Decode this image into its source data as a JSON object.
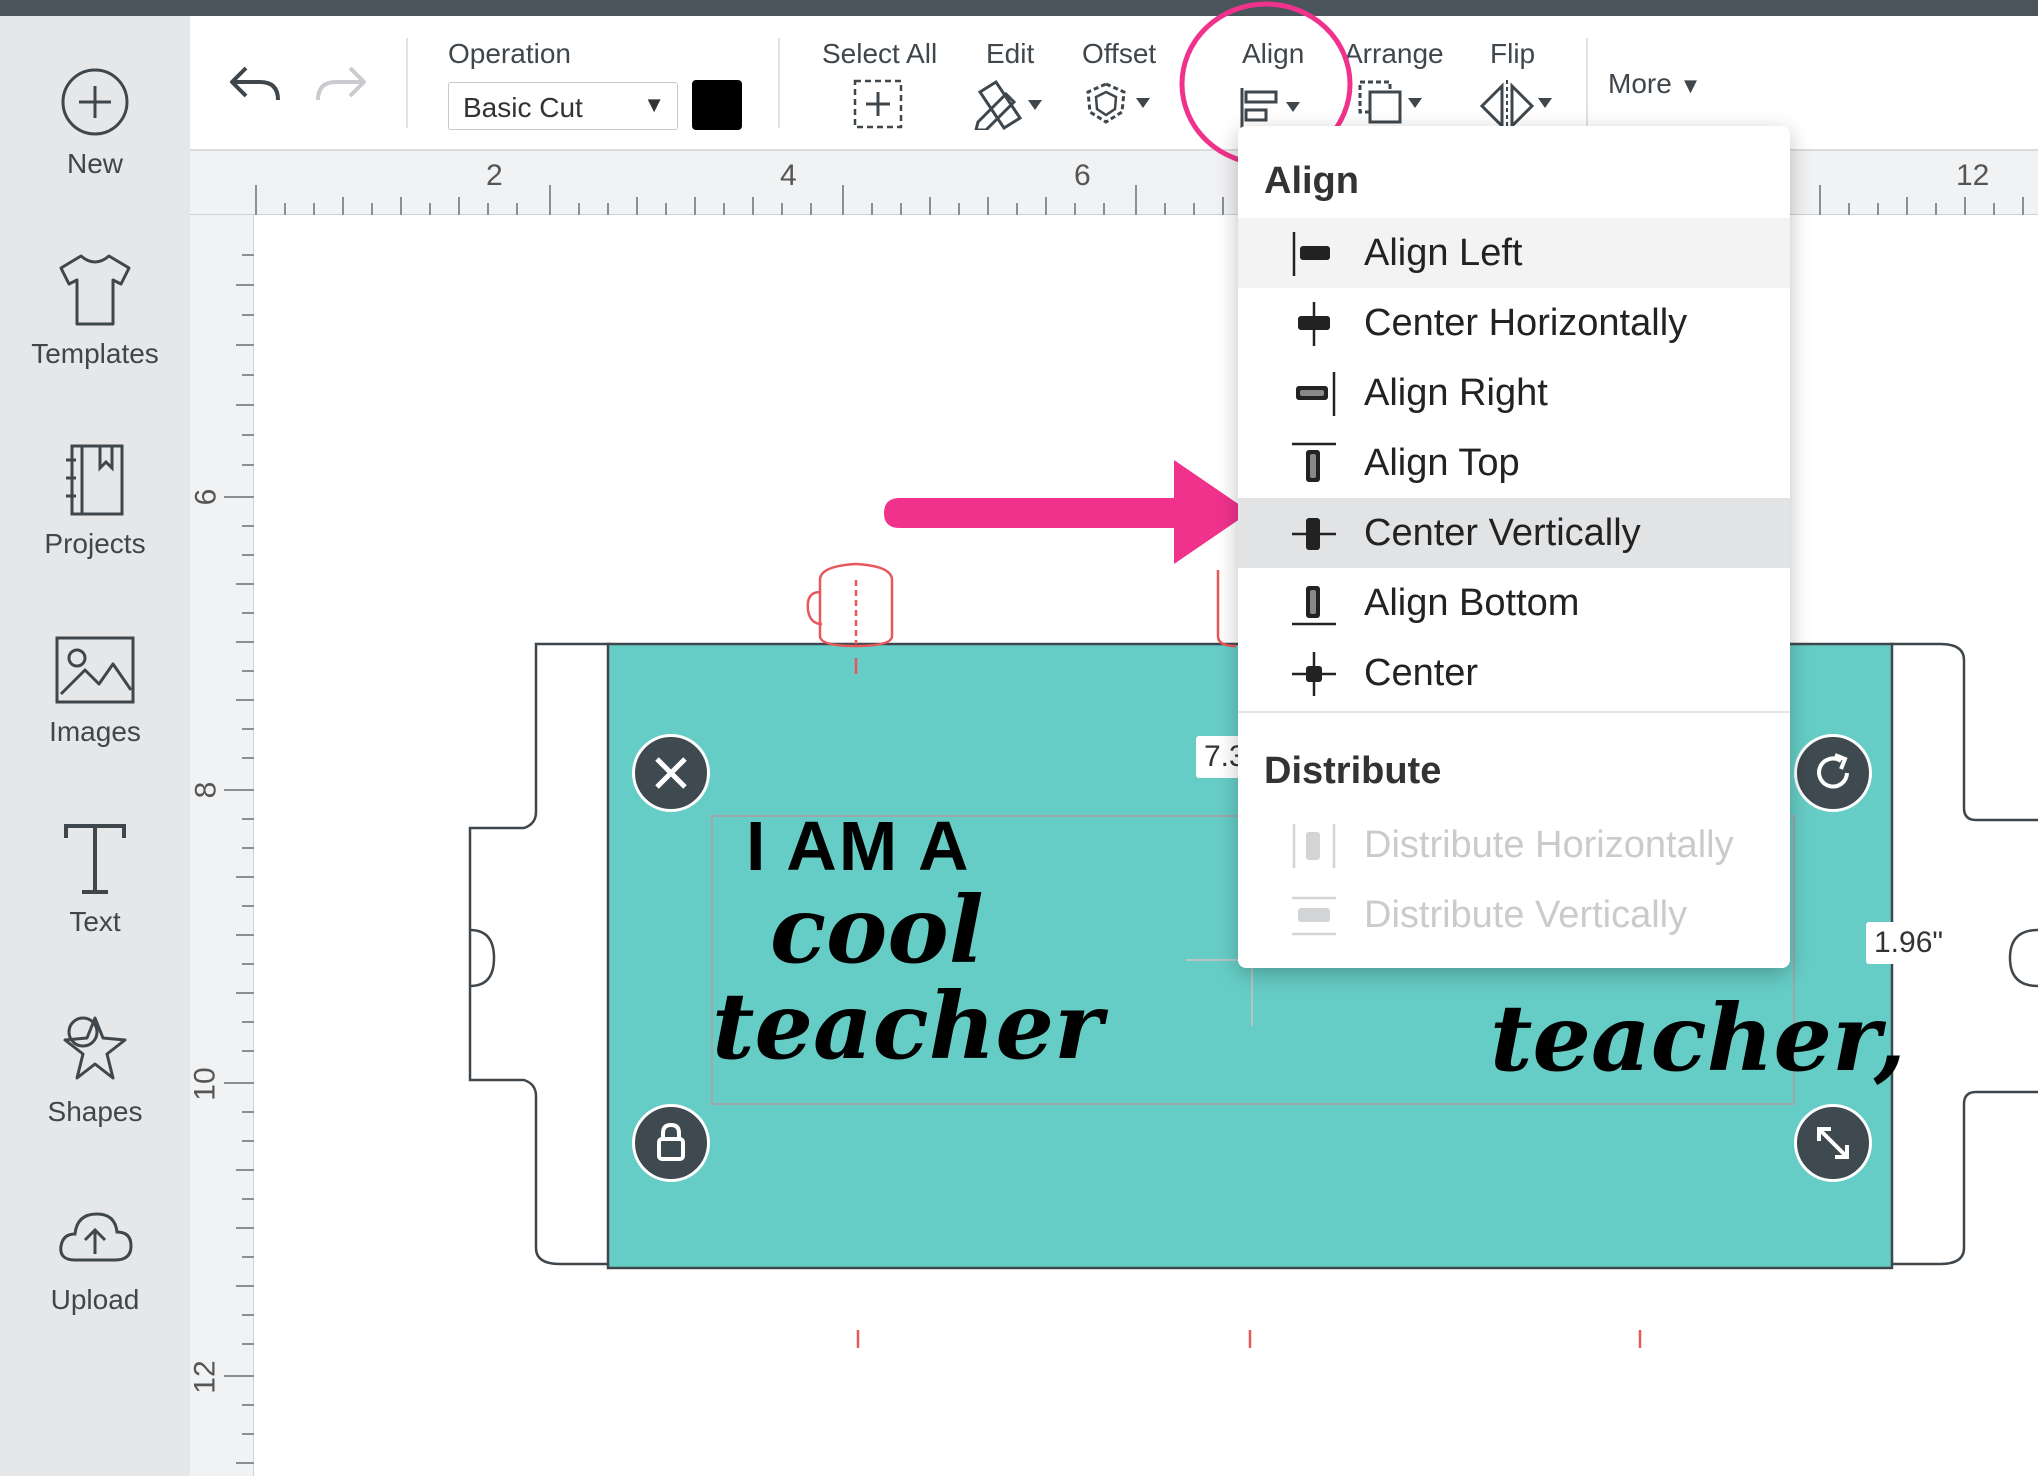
{
  "sidebar": {
    "items": [
      {
        "label": "New",
        "icon": "plus-circle-icon"
      },
      {
        "label": "Templates",
        "icon": "tshirt-icon"
      },
      {
        "label": "Projects",
        "icon": "notebook-icon"
      },
      {
        "label": "Images",
        "icon": "image-icon"
      },
      {
        "label": "Text",
        "icon": "text-t-icon"
      },
      {
        "label": "Shapes",
        "icon": "shapes-icon"
      },
      {
        "label": "Upload",
        "icon": "cloud-upload-icon"
      }
    ]
  },
  "toolbar": {
    "operation_label": "Operation",
    "operation_value": "Basic Cut",
    "operation_color": "#000000",
    "select_all_label": "Select All",
    "edit_label": "Edit",
    "offset_label": "Offset",
    "align_label": "Align",
    "arrange_label": "Arrange",
    "flip_label": "Flip",
    "more_label": "More"
  },
  "ruler": {
    "horizontal": [
      "2",
      "4",
      "6",
      "12"
    ],
    "vertical": [
      "6",
      "8",
      "10",
      "12"
    ]
  },
  "align_menu": {
    "align_heading": "Align",
    "items": [
      {
        "label": "Align Left",
        "icon": "align-left-icon"
      },
      {
        "label": "Center Horizontally",
        "icon": "center-horizontally-icon"
      },
      {
        "label": "Align Right",
        "icon": "align-right-icon"
      },
      {
        "label": "Align Top",
        "icon": "align-top-icon"
      },
      {
        "label": "Center Vertically",
        "icon": "center-vertically-icon"
      },
      {
        "label": "Align Bottom",
        "icon": "align-bottom-icon"
      },
      {
        "label": "Center",
        "icon": "center-icon"
      }
    ],
    "distribute_heading": "Distribute",
    "distribute_items": [
      {
        "label": "Distribute Horizontally",
        "icon": "distribute-horizontally-icon",
        "disabled": true
      },
      {
        "label": "Distribute Vertically",
        "icon": "distribute-vertically-icon",
        "disabled": true
      }
    ]
  },
  "canvas": {
    "width_readout": "7.3",
    "height_readout": "1.96\"",
    "design_text_left_line1": "I AM A",
    "design_text_left_line2": "cool",
    "design_text_left_line3": "teacher",
    "design_text_right": "teacher,",
    "mat_color": "#66cdc6",
    "annotation_color": "#f0328c"
  }
}
